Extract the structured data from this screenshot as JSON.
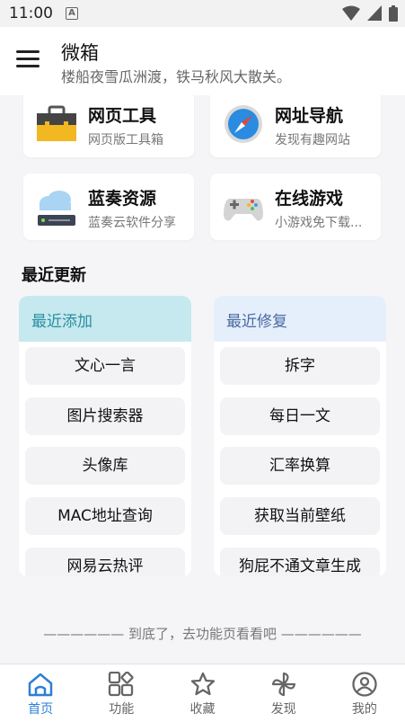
{
  "status_bar": {
    "time": "11:00",
    "notif_glyph": "A"
  },
  "header": {
    "title": "微箱",
    "subtitle": "楼船夜雪瓜洲渡，铁马秋风大散关。"
  },
  "cards": [
    {
      "title": "网页工具",
      "subtitle": "网页版工具箱",
      "icon": "toolbox-icon"
    },
    {
      "title": "网址导航",
      "subtitle": "发现有趣网站",
      "icon": "compass-icon"
    },
    {
      "title": "蓝奏资源",
      "subtitle": "蓝奏云软件分享",
      "icon": "cloud-server-icon"
    },
    {
      "title": "在线游戏",
      "subtitle": "小游戏免下载...",
      "icon": "gamepad-icon"
    }
  ],
  "recent": {
    "title": "最近更新",
    "added": {
      "title": "最近添加",
      "items": [
        "文心一言",
        "图片搜索器",
        "头像库",
        "MAC地址查询",
        "网易云热评"
      ]
    },
    "fixed": {
      "title": "最近修复",
      "items": [
        "拆字",
        "每日一文",
        "汇率换算",
        "获取当前壁纸",
        "狗屁不通文章生成"
      ]
    }
  },
  "footer_note": "——————   到底了，去功能页看看吧   ——————",
  "nav": {
    "home": "首页",
    "features": "功能",
    "favorites": "收藏",
    "discover": "发现",
    "mine": "我的"
  },
  "colors": {
    "accent": "#2e7fd6",
    "added_header_bg": "#c5e9ee",
    "fixed_header_bg": "#e5effc"
  }
}
